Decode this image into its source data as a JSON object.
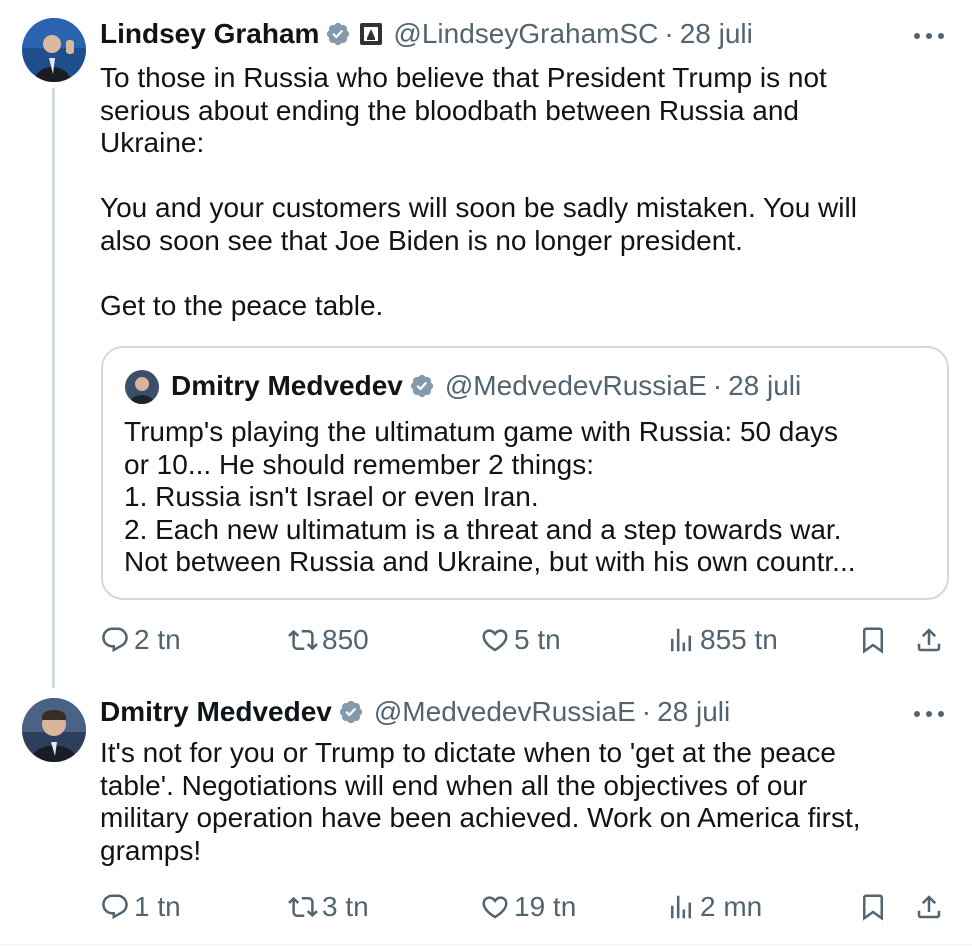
{
  "tweet1": {
    "author": {
      "name": "Lindsey Graham",
      "handle": "@LindseyGrahamSC",
      "time": "28 juli",
      "dot": "·"
    },
    "text": "To those in Russia who believe that President Trump is not\nserious about ending the bloodbath between Russia and\nUkraine:\n\nYou and your customers will soon be sadly mistaken. You will\nalso soon see that Joe Biden is no longer president.\n\nGet to the peace table.",
    "quote": {
      "name": "Dmitry Medvedev",
      "handle": "@MedvedevRussiaE",
      "dot": "·",
      "time": "28 juli",
      "text": "Trump's playing the ultimatum game with Russia: 50 days\nor 10... He should remember 2 things:\n1. Russia isn't Israel or even Iran.\n2. Each new ultimatum is a threat and a step towards war.\nNot between Russia and Ukraine, but with his own countr..."
    },
    "stats": {
      "replies": "2 tn",
      "reposts": "850",
      "likes": "5 tn",
      "views": "855 tn"
    }
  },
  "tweet2": {
    "author": {
      "name": "Dmitry Medvedev",
      "handle": "@MedvedevRussiaE",
      "time": "28 juli",
      "dot": "·"
    },
    "text": "It's not for you or Trump to dictate when to 'get at the peace\ntable'. Negotiations will end when all the objectives of our\nmilitary operation have been achieved. Work on America first,\ngramps!",
    "stats": {
      "replies": "1 tn",
      "reposts": "3 tn",
      "likes": "19 tn",
      "views": "2 mn"
    }
  },
  "colors": {
    "text": "#0f1419",
    "secondary": "#536471",
    "border": "#cfd9de",
    "verified": "#829aab"
  },
  "icons": {
    "verified": "verified-badge-icon",
    "affiliate": "government-affiliation-icon",
    "more": "more-dots-icon",
    "reply": "reply-icon",
    "repost": "repost-icon",
    "like": "heart-icon",
    "views": "views-icon",
    "bookmark": "bookmark-icon",
    "share": "share-icon"
  }
}
